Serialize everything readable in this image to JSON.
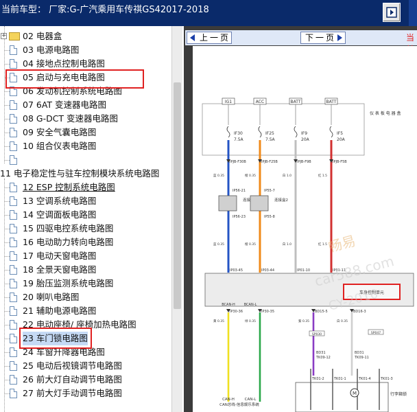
{
  "header": {
    "title": "当前车型：  厂家:G-广汽乘用车传祺GS42017-2018"
  },
  "tree": {
    "items": [
      {
        "label": "02 电器盒",
        "kind": "folder"
      },
      {
        "label": "03 电源电路图",
        "kind": "doc"
      },
      {
        "label": "04 接地点控制电路图",
        "kind": "doc"
      },
      {
        "label": "05 启动与充电电路图",
        "kind": "doc"
      },
      {
        "label": "06 发动机控制系统电路图",
        "kind": "doc"
      },
      {
        "label": "07 6AT 变速器电路图",
        "kind": "doc"
      },
      {
        "label": "08 G-DCT 变速器电路图",
        "kind": "doc"
      },
      {
        "label": "09 安全气囊电路图",
        "kind": "doc"
      },
      {
        "label": "10 组合仪表电路图",
        "kind": "doc"
      },
      {
        "label": "",
        "kind": "doc"
      },
      {
        "label": "11 电子稳定性与驻车控制模块系统电路图",
        "kind": "heading"
      },
      {
        "label": "12 ESP 控制系统电路图",
        "kind": "doc"
      },
      {
        "label": "13 空调系统电路图",
        "kind": "doc"
      },
      {
        "label": "14 空调面板电路图",
        "kind": "doc"
      },
      {
        "label": "15 四驱电控系统电路图",
        "kind": "doc"
      },
      {
        "label": "16 电动助力转向电路图",
        "kind": "doc"
      },
      {
        "label": "17 电动天窗电路图",
        "kind": "doc"
      },
      {
        "label": "18 全景天窗电路图",
        "kind": "doc"
      },
      {
        "label": "19 胎压监测系统电路图",
        "kind": "doc"
      },
      {
        "label": "20 喇叭电路图",
        "kind": "doc"
      },
      {
        "label": "21 辅助电源电路图",
        "kind": "doc"
      },
      {
        "label": "22 电动座椅/ 座椅加热电路图",
        "kind": "doc"
      },
      {
        "label": "23 车门锁电路图",
        "kind": "doc"
      },
      {
        "label": "24 车窗升降器电路图",
        "kind": "doc"
      },
      {
        "label": "25 电动后视镜调节电路图",
        "kind": "doc"
      },
      {
        "label": "26 前大灯自动调节电路图",
        "kind": "doc"
      },
      {
        "label": "27 前大灯手动调节电路图",
        "kind": "doc"
      }
    ]
  },
  "toolbar": {
    "prev_label": "上一页",
    "next_label": "下一页",
    "current_label": "当前"
  },
  "diagram": {
    "fuse_sources": [
      "IG1",
      "ACC",
      "BATT",
      "BATT"
    ],
    "fuses": [
      {
        "name": "IF30",
        "rating": "7.5A"
      },
      {
        "name": "IF25",
        "rating": "7.5A"
      },
      {
        "name": "IF9",
        "rating": "20A"
      },
      {
        "name": "IF5",
        "rating": "20A"
      }
    ],
    "fuse_box_label": "仪表板电器盒",
    "connectors_top": [
      "IPJB-F30B",
      "IPJB-F25B",
      "IPJB-F9B",
      "IPJB-F5B"
    ],
    "wire_labels_top": [
      "蓝 0.35",
      "橙 0.35",
      "白 1.0",
      "红 1.5"
    ],
    "relay_pins_top": [
      "IP56-21",
      "IP55-7"
    ],
    "relay_boxes": [
      "连接盒3",
      "连接盒2"
    ],
    "relay_pins_bottom": [
      "IP56-23",
      "IP55-8"
    ],
    "wire_labels_mid": [
      "蓝 0.35",
      "橙 0.35",
      "白 1.0",
      "红 1.5"
    ],
    "module_pins": [
      "IP03-45",
      "IP03-44",
      "IP01-10",
      "IP01-11"
    ],
    "module_label": "车身控制单元",
    "can_labels": [
      "BCAN-H",
      "BCAN-L"
    ],
    "lower_pins": [
      "IP30-36",
      "IP30-35",
      "BD15-5",
      "BD16-3"
    ],
    "lower_wire_labels": [
      "黄 0.35",
      "绿 0.35",
      "紫 0.35",
      "白 0.35"
    ],
    "splice": [
      "SP030",
      "SP047"
    ],
    "bd_pins": [
      "BD31",
      "TK09-12",
      "BD31",
      "TK09-11"
    ],
    "tk_pins": [
      "TK01-2",
      "TK01-1",
      "TK01-4",
      "TK01-3"
    ],
    "trunk_lock_label": "行李箱锁",
    "bus_labels": [
      "CAN-H",
      "CAN-L",
      "CAN总线-信息娱乐系统"
    ],
    "watermark": [
      "畅易",
      "car588.com",
      "CY-2016"
    ]
  },
  "colors": {
    "title_bg": "#0a2a6a",
    "highlight_red": "#e02020",
    "selection": "#c5daf5"
  }
}
